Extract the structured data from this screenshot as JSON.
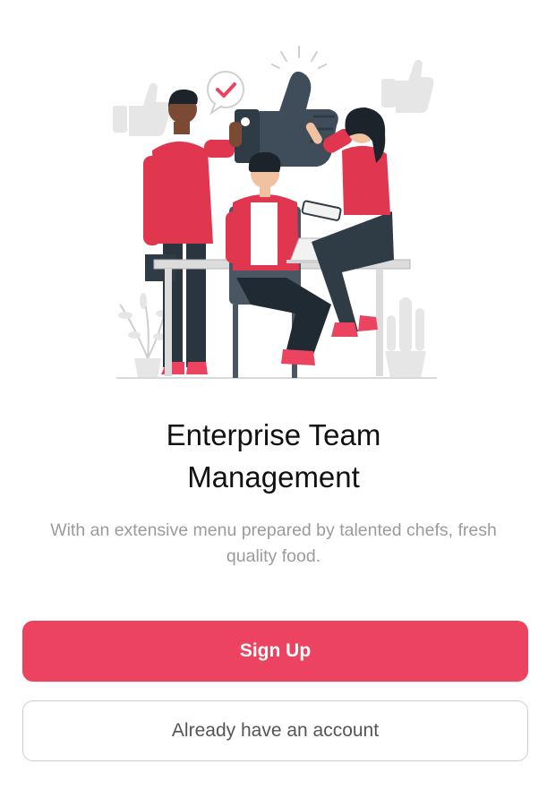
{
  "onboarding": {
    "illustration_icon": "team-thumbs-up-illustration",
    "title_line1": "Enterprise Team",
    "title_line2": "Management",
    "subtitle": "With an extensive menu prepared by talented chefs, fresh quality food.",
    "primary_button_label": "Sign Up",
    "secondary_button_label": "Already have an account"
  },
  "colors": {
    "accent": "#ec4460",
    "title_text": "#111111",
    "subtitle_text": "#9b9b9b",
    "secondary_text": "#555555",
    "dark_navy": "#2f3c46",
    "muted_gray": "#e6e6e6"
  }
}
